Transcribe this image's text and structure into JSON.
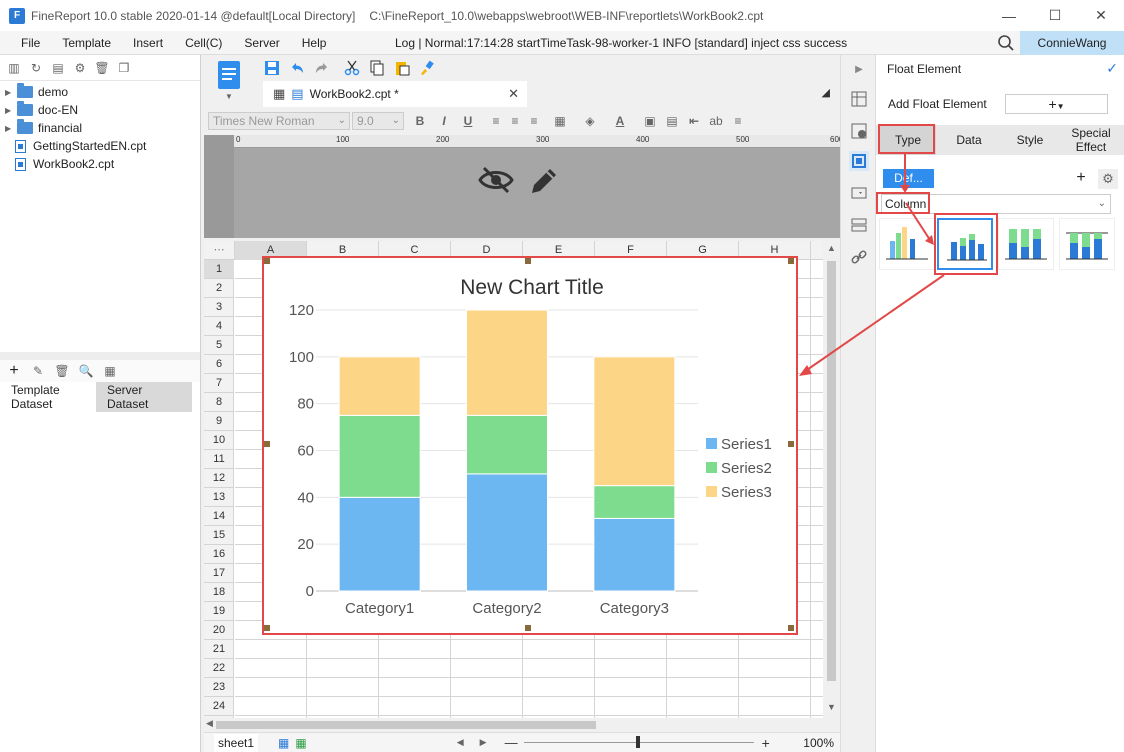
{
  "window": {
    "title": "FineReport 10.0 stable 2020-01-14 @default[Local Directory]",
    "path": "C:\\FineReport_10.0\\webapps\\webroot\\WEB-INF\\reportlets\\WorkBook2.cpt",
    "logo": "F"
  },
  "menu": {
    "items": [
      "File",
      "Template",
      "Insert",
      "Cell(C)",
      "Server",
      "Help"
    ],
    "log": "Log | Normal:17:14:28 startTimeTask-98-worker-1 INFO [standard] inject css success",
    "user": "ConnieWang"
  },
  "tree": {
    "items": [
      {
        "label": "demo",
        "type": "folder"
      },
      {
        "label": "doc-EN",
        "type": "folder"
      },
      {
        "label": "financial",
        "type": "folder"
      },
      {
        "label": "GettingStartedEN.cpt",
        "type": "file"
      },
      {
        "label": "WorkBook2.cpt",
        "type": "file"
      }
    ]
  },
  "dataset": {
    "tabs": [
      "Template\nDataset",
      "Server\nDataset"
    ]
  },
  "editor": {
    "tab_label": "WorkBook2.cpt *",
    "font_name": "Times New Roman",
    "font_size": "9.0",
    "bold": "B",
    "italic": "I",
    "underline": "U",
    "ab": "ab",
    "ruler_marks": [
      "0",
      "100",
      "200",
      "300",
      "400",
      "500",
      "600"
    ],
    "columns": [
      "A",
      "B",
      "C",
      "D",
      "E",
      "F",
      "G",
      "H"
    ],
    "rows": [
      "1",
      "2",
      "3",
      "4",
      "5",
      "6",
      "7",
      "8",
      "9",
      "10",
      "11",
      "12",
      "13",
      "14",
      "15",
      "16",
      "17",
      "18",
      "19",
      "20",
      "21",
      "22",
      "23",
      "24"
    ],
    "sheet": "sheet1",
    "zoom": "100%"
  },
  "right_panel": {
    "title": "Float Element",
    "add_label": "Add Float Element",
    "add_btn": "+",
    "tabs": [
      "Type",
      "Data",
      "Style",
      "Special\nEffect"
    ],
    "def_btn": "Def...",
    "chart_type": "Column"
  },
  "colors": {
    "series1": "#6cb6f2",
    "series2": "#7edc8f",
    "series3": "#fdd587",
    "highlight": "#e24848",
    "accent": "#2f8ded"
  },
  "chart_data": {
    "type": "bar",
    "stacked": true,
    "title": "New Chart Title",
    "categories": [
      "Category1",
      "Category2",
      "Category3"
    ],
    "series": [
      {
        "name": "Series1",
        "values": [
          40,
          50,
          31
        ]
      },
      {
        "name": "Series2",
        "values": [
          35,
          25,
          14
        ]
      },
      {
        "name": "Series3",
        "values": [
          25,
          45,
          55
        ]
      }
    ],
    "ylim": [
      0,
      120
    ],
    "yticks": [
      0,
      20,
      40,
      60,
      80,
      100,
      120
    ],
    "legend": "right",
    "grid": true
  }
}
